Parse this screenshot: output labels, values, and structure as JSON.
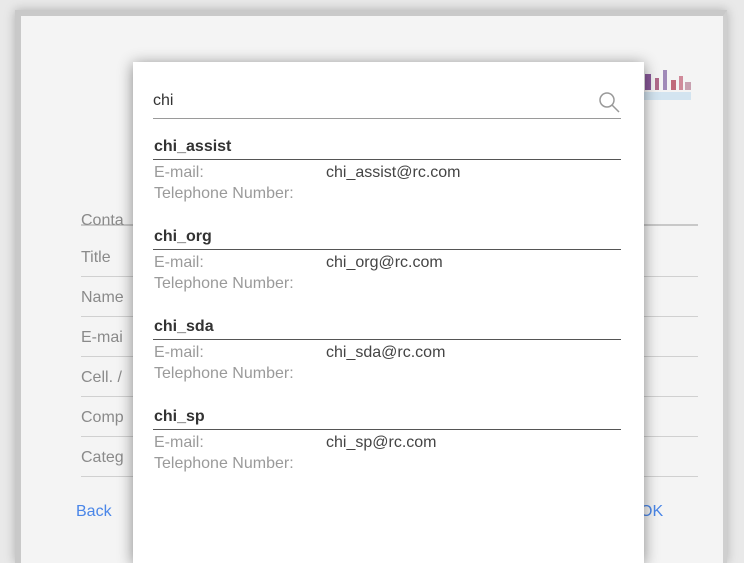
{
  "background_form": {
    "labels": [
      "Conta",
      "Title",
      "Name",
      "E-mai",
      "Cell. /",
      "Comp",
      "Categ"
    ],
    "back_label": "Back",
    "ok_label": "OK"
  },
  "search": {
    "value": "chi"
  },
  "results": [
    {
      "name": "chi_assist",
      "email_label": "E-mail:",
      "email": "chi_assist@rc.com",
      "phone_label": "Telephone Number:"
    },
    {
      "name": "chi_org",
      "email_label": "E-mail:",
      "email": "chi_org@rc.com",
      "phone_label": "Telephone Number:"
    },
    {
      "name": "chi_sda",
      "email_label": "E-mail:",
      "email": "chi_sda@rc.com",
      "phone_label": "Telephone Number:"
    },
    {
      "name": "chi_sp",
      "email_label": "E-mail:",
      "email": "chi_sp@rc.com",
      "phone_label": "Telephone Number:"
    }
  ],
  "colors": {
    "link": "#4a86e8",
    "label": "#9a9a9a",
    "text": "#333333"
  }
}
